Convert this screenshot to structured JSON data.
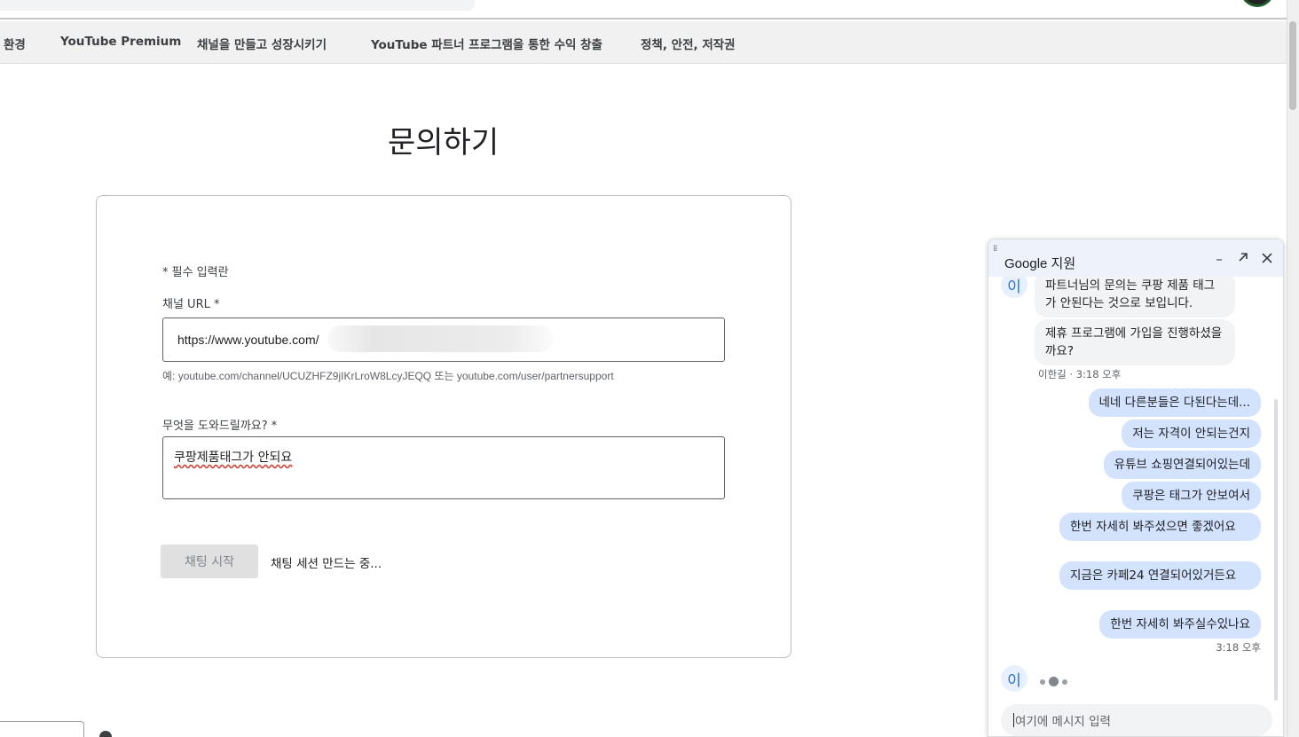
{
  "nav": {
    "items": [
      "환경",
      "YouTube Premium",
      "채널을 만들고 성장시키기",
      "YouTube 파트너 프로그램을 통한 수익 창출",
      "정책, 안전, 저작권"
    ]
  },
  "page": {
    "title": "문의하기"
  },
  "form": {
    "required_note": "* 필수 입력란",
    "url_label": "채널 URL *",
    "url_value": "https://www.youtube.com/",
    "url_hint": "예: youtube.com/channel/UCUZHFZ9jIKrLroW8LcyJEQQ 또는 youtube.com/user/partnersupport",
    "help_label": "무엇을 도와드릴까요? *",
    "help_value": "쿠팡제품태그가 안되요",
    "chat_button_label": "채팅 시작",
    "session_status": "채팅 세션 만드는 중..."
  },
  "chat": {
    "title": "Google 지원",
    "minimize_icon": "minimize-icon",
    "popout_icon": "popout-icon",
    "close_icon": "close-icon",
    "agent_initial": "이",
    "agent_messages": [
      "파트너님의 문의는 쿠팡 제품 태그가 안된다는 것으로 보입니다.",
      "제휴 프로그램에 가입을 진행하셨을까요?"
    ],
    "agent_meta": "이한길 · 3:18 오후",
    "user_messages": [
      "네네 다른분들은 다된다는데...",
      "저는 자격이 안되는건지",
      "유튜브 쇼핑연결되어있는데",
      "쿠팡은 태그가 안보여서",
      "한번 자세히 봐주셨으면 좋겠어요",
      "지금은 카페24 연결되어있거든요",
      "한번 자세히 봐주실수있나요"
    ],
    "user_meta": "3:18 오후",
    "input_placeholder": "여기에 메시지 입력"
  },
  "colors": {
    "user_bubble": "#d3e3fd",
    "agent_bubble": "#f1f3f4",
    "header_bg": "#eef3fb",
    "accent": "#1a73e8"
  }
}
